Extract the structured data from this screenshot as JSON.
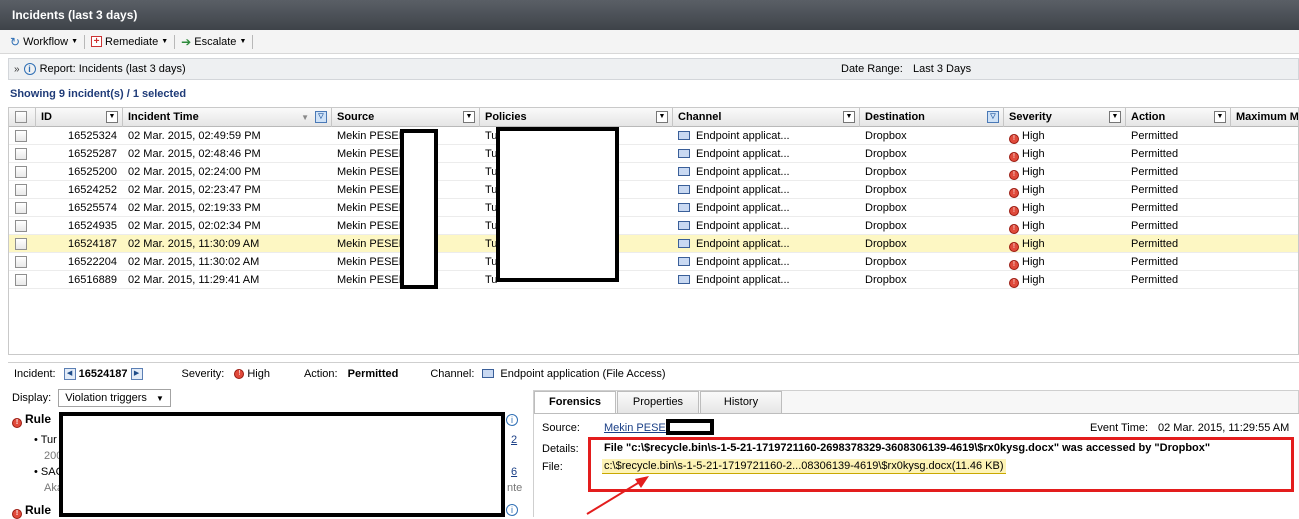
{
  "window": {
    "title": "Incidents (last 3 days)"
  },
  "toolbar": {
    "workflow": "Workflow",
    "remediate": "Remediate",
    "escalate": "Escalate"
  },
  "report": {
    "label": "Report: Incidents (last 3 days)",
    "date_range_label": "Date Range:",
    "date_range_value": "Last 3 Days"
  },
  "summary": "Showing 9 incident(s) / 1 selected",
  "columns": [
    "ID",
    "Incident Time",
    "Source",
    "Policies",
    "Channel",
    "Destination",
    "Severity",
    "Action",
    "Maximum M"
  ],
  "rows": [
    {
      "id": "16525324",
      "time": "02 Mar. 2015, 02:49:59 PM",
      "source": "Mekin PESEN",
      "policies": "Tu",
      "channel": "Endpoint applicat...",
      "destination": "Dropbox",
      "severity": "High",
      "action": "Permitted"
    },
    {
      "id": "16525287",
      "time": "02 Mar. 2015, 02:48:46 PM",
      "source": "Mekin PESEN",
      "policies": "Tu",
      "channel": "Endpoint applicat...",
      "destination": "Dropbox",
      "severity": "High",
      "action": "Permitted"
    },
    {
      "id": "16525200",
      "time": "02 Mar. 2015, 02:24:00 PM",
      "source": "Mekin PESEN",
      "policies": "Tu",
      "channel": "Endpoint applicat...",
      "destination": "Dropbox",
      "severity": "High",
      "action": "Permitted"
    },
    {
      "id": "16524252",
      "time": "02 Mar. 2015, 02:23:47 PM",
      "source": "Mekin PESEN",
      "policies": "Tu",
      "channel": "Endpoint applicat...",
      "destination": "Dropbox",
      "severity": "High",
      "action": "Permitted"
    },
    {
      "id": "16525574",
      "time": "02 Mar. 2015, 02:19:33 PM",
      "source": "Mekin PESEN",
      "policies": "Tu",
      "channel": "Endpoint applicat...",
      "destination": "Dropbox",
      "severity": "High",
      "action": "Permitted"
    },
    {
      "id": "16524935",
      "time": "02 Mar. 2015, 02:02:34 PM",
      "source": "Mekin PESEN",
      "policies": "Tu",
      "channel": "Endpoint applicat...",
      "destination": "Dropbox",
      "severity": "High",
      "action": "Permitted"
    },
    {
      "id": "16524187",
      "time": "02 Mar. 2015, 11:30:09 AM",
      "source": "Mekin PESEN",
      "policies": "Tu",
      "channel": "Endpoint applicat...",
      "destination": "Dropbox",
      "severity": "High",
      "action": "Permitted",
      "selected": true
    },
    {
      "id": "16522204",
      "time": "02 Mar. 2015, 11:30:02 AM",
      "source": "Mekin PESEN",
      "policies": "Tu",
      "channel": "Endpoint applicat...",
      "destination": "Dropbox",
      "severity": "High",
      "action": "Permitted"
    },
    {
      "id": "16516889",
      "time": "02 Mar. 2015, 11:29:41 AM",
      "source": "Mekin PESEN",
      "policies": "Tu",
      "channel": "Endpoint applicat...",
      "destination": "Dropbox",
      "severity": "High",
      "action": "Permitted"
    }
  ],
  "incident": {
    "label": "Incident:",
    "id": "16524187",
    "severity_label": "Severity:",
    "severity": "High",
    "action_label": "Action:",
    "action": "Permitted",
    "channel_label": "Channel:",
    "channel": "Endpoint application (File Access)"
  },
  "display": {
    "label": "Display:",
    "value": "Violation triggers"
  },
  "rules": {
    "heading1": "Rule",
    "heading2": "Rule",
    "items": [
      {
        "text": "Tur",
        "sub": "200",
        "count": "2"
      },
      {
        "text": "SAC",
        "sub": "Aka",
        "count": "6",
        "trail": "nte"
      }
    ]
  },
  "tabs": [
    "Forensics",
    "Properties",
    "History"
  ],
  "forensics": {
    "source_label": "Source:",
    "source": "Mekin PESEN",
    "event_time_label": "Event Time:",
    "event_time": "02 Mar. 2015, 11:29:55 AM",
    "details_label": "Details:",
    "details": "File \"c:\\$recycle.bin\\s-1-5-21-1719721160-2698378329-3608306139-4619\\$rx0kysg.docx\" was accessed by \"Dropbox\"",
    "file_label": "File:",
    "file": "c:\\$recycle.bin\\s-1-5-21-1719721160-2...08306139-4619\\$rx0kysg.docx(11.46 KB)"
  },
  "colors": {
    "title_bar": "#4a4f55",
    "selected_row": "#fdf7c3",
    "highlight_box": "#e31d1d",
    "link": "#1a3f86"
  }
}
